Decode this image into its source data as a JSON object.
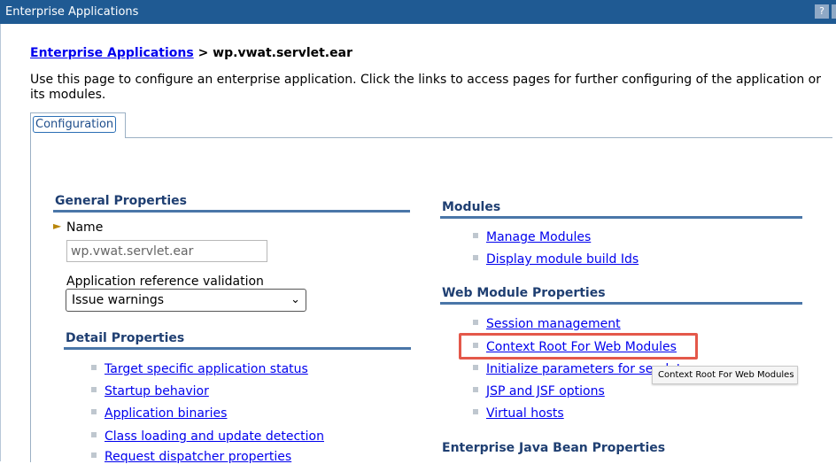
{
  "window": {
    "title": "Enterprise Applications",
    "help_label": "?"
  },
  "breadcrumb": {
    "parent": "Enterprise Applications",
    "separator": ">",
    "current": "wp.vwat.servlet.ear"
  },
  "description": "Use this page to configure an enterprise application. Click the links to access pages for further configuring of the application or its modules.",
  "tabs": [
    {
      "label": "Configuration",
      "selected": true
    }
  ],
  "general": {
    "heading": "General Properties",
    "name_label": "Name",
    "name_value": "wp.vwat.servlet.ear",
    "validation_label": "Application reference validation",
    "validation_value": "Issue warnings"
  },
  "detail": {
    "heading": "Detail Properties",
    "items": [
      "Target specific application status",
      "Startup behavior",
      "Application binaries",
      "Class loading and update detection",
      "Request dispatcher properties"
    ]
  },
  "modules": {
    "heading": "Modules",
    "items": [
      "Manage Modules",
      "Display module build Ids"
    ]
  },
  "web_module": {
    "heading": "Web Module Properties",
    "items": [
      "Session management",
      "Context Root For Web Modules",
      "Initialize parameters for servlets",
      "JSP and JSF options",
      "Virtual hosts"
    ]
  },
  "ejb": {
    "heading": "Enterprise Java Bean Properties"
  },
  "tooltip": "Context Root For Web Modules",
  "highlight_color": "#e4584a"
}
